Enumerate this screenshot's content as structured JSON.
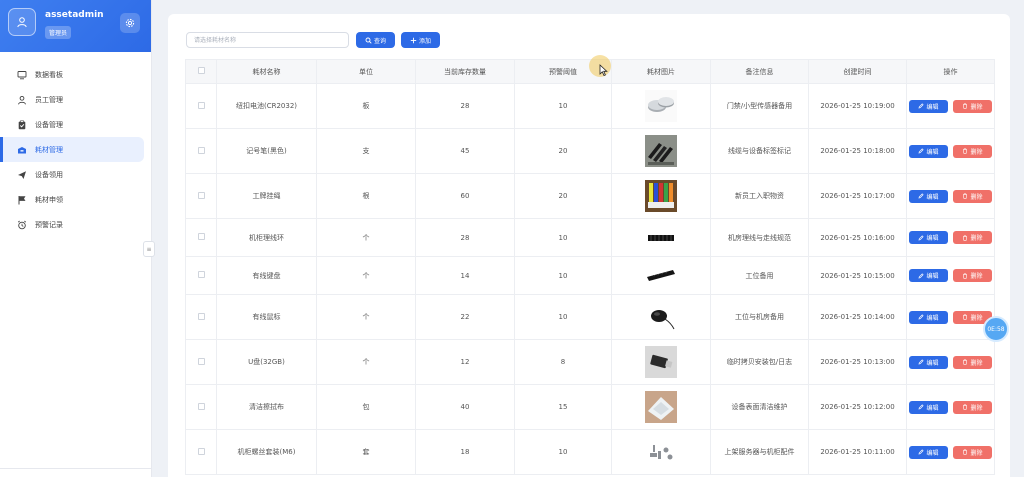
{
  "user": {
    "name": "assetadmin",
    "role": "管理员"
  },
  "nav": [
    {
      "label": "数据看板",
      "icon": "dashboard-icon",
      "active": false
    },
    {
      "label": "员工管理",
      "icon": "user-icon",
      "active": false
    },
    {
      "label": "设备管理",
      "icon": "clipboard-icon",
      "active": false
    },
    {
      "label": "耗材管理",
      "icon": "box-icon",
      "active": true
    },
    {
      "label": "设备领用",
      "icon": "send-icon",
      "active": false
    },
    {
      "label": "耗材申领",
      "icon": "flag-icon",
      "active": false
    },
    {
      "label": "预警记录",
      "icon": "alarm-icon",
      "active": false
    }
  ],
  "toolbar": {
    "search_placeholder": "请选择耗材名称",
    "query_label": "查询",
    "add_label": "添加"
  },
  "table": {
    "headers": [
      "耗材名称",
      "单位",
      "当前库存数量",
      "预警阈值",
      "耗材图片",
      "备注信息",
      "创建时间",
      "操作"
    ],
    "rows": [
      {
        "name": "纽扣电池(CR2032)",
        "unit": "板",
        "stock": "28",
        "threshold": "10",
        "image": "coin-battery",
        "note": "门禁/小型传感器备用",
        "created": "2026-01-25 10:19:00"
      },
      {
        "name": "记号笔(黑色)",
        "unit": "支",
        "stock": "45",
        "threshold": "20",
        "image": "markers",
        "note": "线缆与设备标签标记",
        "created": "2026-01-25 10:18:00"
      },
      {
        "name": "工牌挂绳",
        "unit": "根",
        "stock": "60",
        "threshold": "20",
        "image": "lanyards",
        "note": "新员工入职物资",
        "created": "2026-01-25 10:17:00"
      },
      {
        "name": "机柜理线环",
        "unit": "个",
        "stock": "28",
        "threshold": "10",
        "image": "cable-manager",
        "note": "机房理线与走线规范",
        "created": "2026-01-25 10:16:00"
      },
      {
        "name": "有线键盘",
        "unit": "个",
        "stock": "14",
        "threshold": "10",
        "image": "keyboard",
        "note": "工位备用",
        "created": "2026-01-25 10:15:00"
      },
      {
        "name": "有线鼠标",
        "unit": "个",
        "stock": "22",
        "threshold": "10",
        "image": "mouse",
        "note": "工位与机房备用",
        "created": "2026-01-25 10:14:00"
      },
      {
        "name": "U盘(32GB)",
        "unit": "个",
        "stock": "12",
        "threshold": "8",
        "image": "usb-drive",
        "note": "临时拷贝安装包/日志",
        "created": "2026-01-25 10:13:00"
      },
      {
        "name": "清洁擦拭布",
        "unit": "包",
        "stock": "40",
        "threshold": "15",
        "image": "wipes",
        "note": "设备表面清洁维护",
        "created": "2026-01-25 10:12:00"
      },
      {
        "name": "机柜螺丝套装(M6)",
        "unit": "套",
        "stock": "18",
        "threshold": "10",
        "image": "rack-screws",
        "note": "上架服务器与机柜配件",
        "created": "2026-01-25 10:11:00"
      }
    ],
    "edit_label": "编辑",
    "delete_label": "删除"
  },
  "float_bubble": "0E:58",
  "colors": {
    "primary": "#2d6ae6",
    "danger": "#f07068",
    "active_bg": "#e9f0fe"
  }
}
